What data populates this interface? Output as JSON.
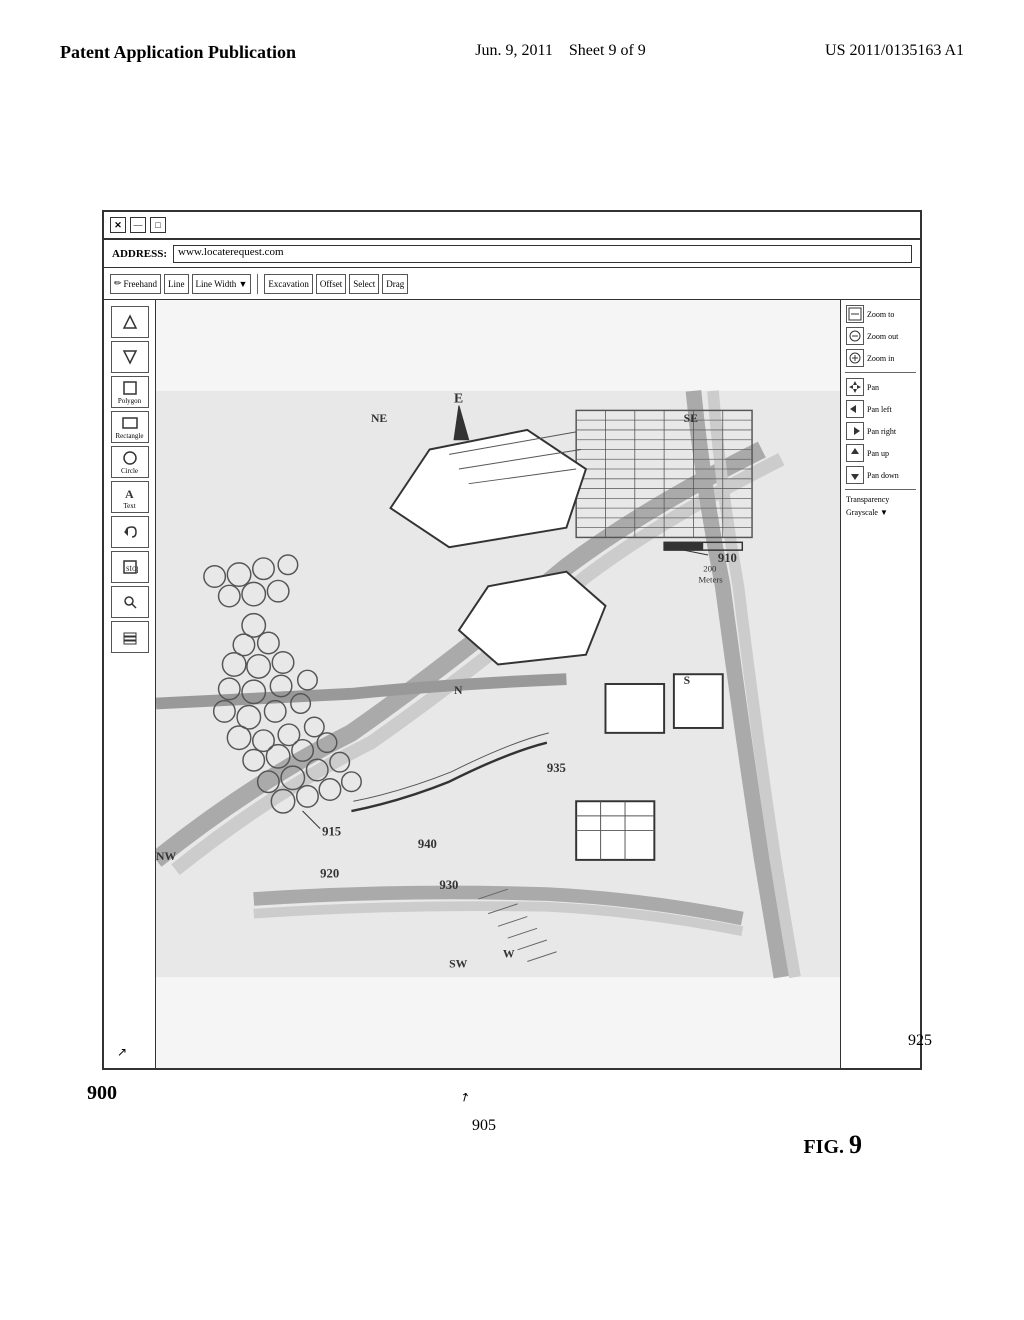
{
  "header": {
    "left": "Patent Application Publication",
    "center_date": "Jun. 9, 2011",
    "center_sheet": "Sheet 9 of 9",
    "right": "US 2011/0135163 A1"
  },
  "figure": {
    "number": "FIG. 9",
    "ref_900": "900",
    "ref_905": "905",
    "ref_910": "910",
    "ref_915": "915",
    "ref_920": "920",
    "ref_925": "925",
    "ref_930": "930",
    "ref_935": "935",
    "ref_940": "940"
  },
  "app": {
    "title_buttons": [
      "×",
      "□",
      "—"
    ],
    "address_label": "ADDRESS:",
    "address_value": "www.locaterequest.com",
    "toolbar_items": [
      "Freehand",
      "Line",
      "Line Width ▼",
      "Excavation",
      "Offset",
      "Select",
      "Drag"
    ]
  },
  "tools": {
    "left": [
      {
        "icon": "arrow-up",
        "label": ""
      },
      {
        "icon": "arrow-down",
        "label": ""
      },
      {
        "icon": "polygon",
        "label": "Polygon"
      },
      {
        "icon": "rectangle",
        "label": "Rectangle"
      },
      {
        "icon": "circle",
        "label": "Circle"
      },
      {
        "icon": "text",
        "label": "Text"
      },
      {
        "icon": "undo",
        "label": ""
      },
      {
        "icon": "stop",
        "label": ""
      },
      {
        "icon": "magnify",
        "label": ""
      },
      {
        "icon": "layers",
        "label": ""
      }
    ],
    "right": [
      {
        "icon": "zoom-to",
        "label": "Zoom to"
      },
      {
        "icon": "zoom-out",
        "label": "Zoom out"
      },
      {
        "icon": "zoom-in",
        "label": "Zoom in"
      },
      {
        "icon": "pan",
        "label": "Pan"
      },
      {
        "icon": "pan-left",
        "label": "Pan left"
      },
      {
        "icon": "pan-right",
        "label": "Pan right"
      },
      {
        "icon": "pan-up",
        "label": "Pan up"
      },
      {
        "icon": "pan-down",
        "label": "Pan down"
      },
      {
        "icon": "transparency",
        "label": "Transparency"
      },
      {
        "icon": "grayscale",
        "label": "Grayscale"
      }
    ]
  },
  "compass": {
    "NE": "NE",
    "SE": "SE",
    "NW": "NW",
    "SW": "SW",
    "N": "N",
    "S": "S",
    "E": "E",
    "W": "W"
  },
  "map_labels": {
    "meters": "200 Meters",
    "ref_numbers": [
      "915",
      "920",
      "930",
      "935",
      "940",
      "910"
    ]
  }
}
